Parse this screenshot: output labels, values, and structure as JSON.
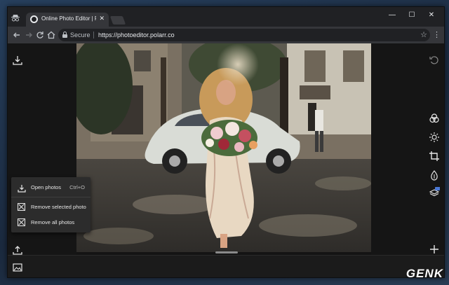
{
  "browser": {
    "tab_title": "Online Photo Editor | Pola",
    "tab_close": "✕",
    "window_controls": {
      "minimize": "—",
      "maximize": "☐",
      "close": "✕"
    },
    "omnibox": {
      "secure_label": "Secure",
      "url": "https://photoeditor.polarr.co"
    }
  },
  "editor": {
    "left_tools": [
      "download-icon",
      "upload-icon"
    ],
    "right_tools": [
      "history-icon",
      "filters-icon",
      "adjust-icon",
      "crop-icon",
      "retouch-icon",
      "layers-icon",
      "add-icon"
    ],
    "layers_badge": "PRO",
    "context_menu": {
      "items": [
        {
          "label": "Open photos",
          "shortcut": "Ctrl+O",
          "icon": "download-icon"
        },
        {
          "label": "Remove selected photo",
          "icon": "remove-box-icon"
        },
        {
          "label": "Remove all photos",
          "icon": "remove-box-icon"
        }
      ]
    },
    "bottom_bar": {
      "thumbnail_icon": "image-thumbnail-icon"
    }
  },
  "watermark": "GENK",
  "colors": {
    "chrome_dark": "#202124",
    "chrome_toolbar": "#35363a",
    "app_bg": "#151515",
    "menu_bg": "#2c2c2c"
  }
}
